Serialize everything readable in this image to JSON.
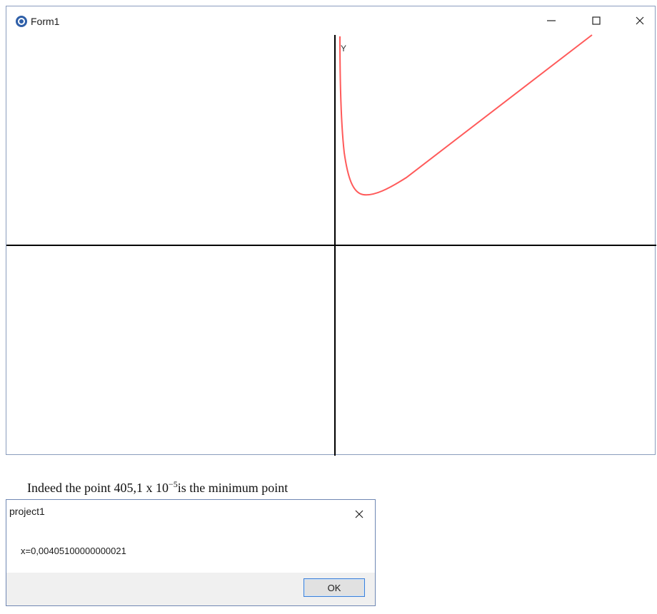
{
  "window": {
    "title": "Form1",
    "axis_y_label": "Y"
  },
  "caption": {
    "text_before": "Indeed the point 405,1 x 10",
    "exponent": "−5",
    "text_after": "is the minimum point"
  },
  "dialog": {
    "title": "project1",
    "message": "x=0,00405100000000021",
    "ok_label": "OK"
  },
  "icons": {
    "app": "app-icon",
    "minimize": "minimize-icon",
    "maximize": "maximize-icon",
    "close": "close-icon"
  },
  "colors": {
    "curve": "#ff5a5a",
    "axes": "#000000",
    "window_border": "#8a9cbd",
    "button_border": "#3c7fd8"
  }
}
